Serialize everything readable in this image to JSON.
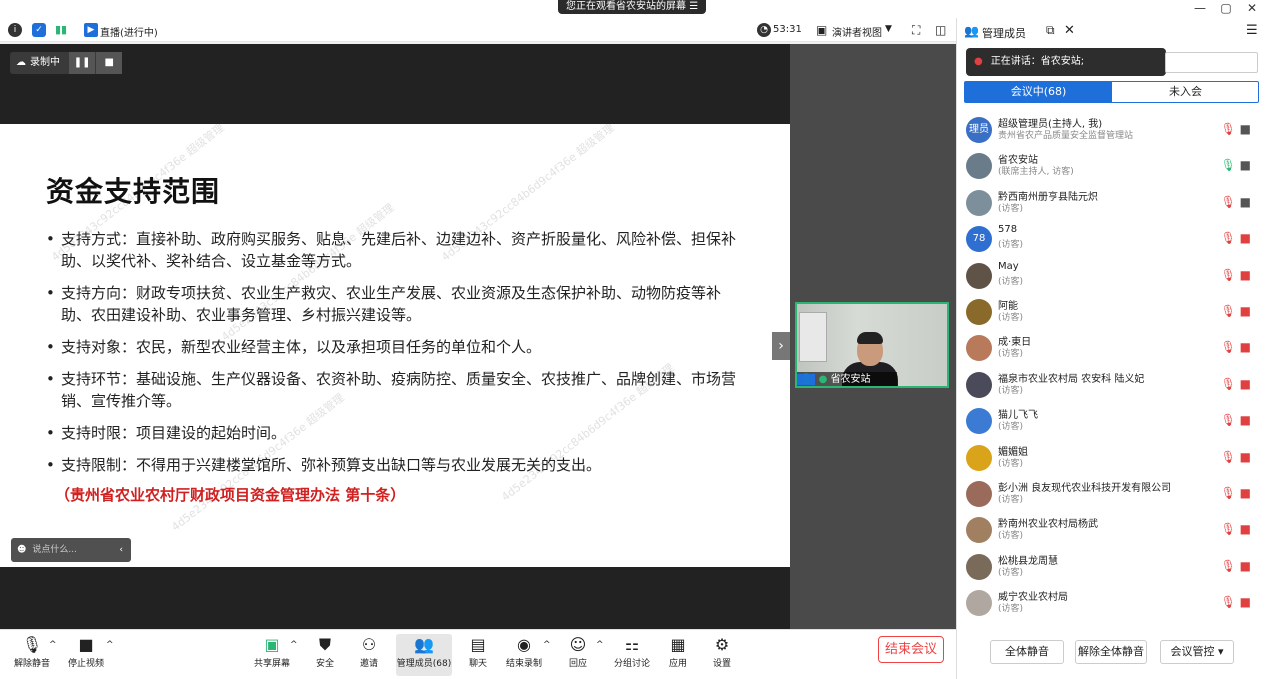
{
  "banner": {
    "text": "您正在观看省农安站的屏幕",
    "icon": "menu-icon"
  },
  "window": {
    "minimize": "—",
    "restore": "▢",
    "close": "✕"
  },
  "meeting_bar": {
    "live_label": "直播(进行中)",
    "timer": "53:31",
    "view_label": "演讲者视图"
  },
  "recording": {
    "label": "录制中"
  },
  "slide": {
    "title": "资金支持范围",
    "bullets": [
      "支持方式：直接补助、政府购买服务、贴息、先建后补、边建边补、资产折股量化、风险补偿、担保补助、以奖代补、奖补结合、设立基金等方式。",
      "支持方向：财政专项扶贫、农业生产救灾、农业生产发展、农业资源及生态保护补助、动物防疫等补助、农田建设补助、农业事务管理、乡村振兴建设等。",
      "支持对象：农民，新型农业经营主体，以及承担项目任务的单位和个人。",
      "支持环节：基础设施、生产仪器设备、农资补助、疫病防控、质量安全、农技推广、品牌创建、市场营销、宣传推介等。",
      "支持时限：项目建设的起始时间。",
      "支持限制：不得用于兴建楼堂馆所、弥补预算支出缺口等与农业发展无关的支出。"
    ],
    "note": "（贵州省农业农村厅财政项目资金管理办法 第十条）"
  },
  "chat": {
    "placeholder": "说点什么..."
  },
  "video": {
    "caption": "省农安站"
  },
  "toolbar": {
    "unmute": "解除静音",
    "stop_video": "停止视频",
    "share": "共享屏幕",
    "security": "安全",
    "invite": "邀请",
    "members": "管理成员(68)",
    "chat": "聊天",
    "end_record": "结束录制",
    "reactions": "回应",
    "breakout": "分组讨论",
    "apps": "应用",
    "settings": "设置",
    "end_meeting": "结束会议"
  },
  "panel": {
    "title": "管理成员",
    "speaking": "正在讲话：省农安站;",
    "tab_in": "会议中(68)",
    "tab_out": "未入会",
    "members": [
      {
        "name": "超级管理员(主持人, 我)",
        "role": "贵州省农产品质量安全监督管理站",
        "avatar": "理员",
        "mic": "off",
        "cam": "on"
      },
      {
        "name": "省农安站",
        "role": "(联席主持人, 访客)",
        "avatar": "",
        "mic": "on",
        "cam": "on"
      },
      {
        "name": "黔西南州册亨县陆元炽",
        "role": "(访客)",
        "avatar": "",
        "mic": "off",
        "cam": "on"
      },
      {
        "name": "578",
        "role": "(访客)",
        "avatar": "78",
        "mic": "off",
        "cam": "off"
      },
      {
        "name": "May",
        "role": "(访客)",
        "avatar": "",
        "mic": "off",
        "cam": "off"
      },
      {
        "name": "阿能",
        "role": "(访客)",
        "avatar": "",
        "mic": "off",
        "cam": "off"
      },
      {
        "name": "成·東日",
        "role": "(访客)",
        "avatar": "",
        "mic": "off",
        "cam": "off"
      },
      {
        "name": "福泉市农业农村局 农安科 陆义妃",
        "role": "(访客)",
        "avatar": "",
        "mic": "off",
        "cam": "off"
      },
      {
        "name": "猫儿飞飞",
        "role": "(访客)",
        "avatar": "",
        "mic": "off",
        "cam": "off"
      },
      {
        "name": "媚媚姐",
        "role": "(访客)",
        "avatar": "",
        "mic": "off",
        "cam": "off"
      },
      {
        "name": "彭小洲 良友现代农业科技开发有限公司",
        "role": "(访客)",
        "avatar": "",
        "mic": "off",
        "cam": "off"
      },
      {
        "name": "黔南州农业农村局杨武",
        "role": "(访客)",
        "avatar": "",
        "mic": "off",
        "cam": "off"
      },
      {
        "name": "松桃县龙周慧",
        "role": "(访客)",
        "avatar": "",
        "mic": "off",
        "cam": "off"
      },
      {
        "name": "威宁农业农村局",
        "role": "(访客)",
        "avatar": "",
        "mic": "off",
        "cam": "off"
      }
    ],
    "mute_all": "全体静音",
    "unmute_all": "解除全体静音",
    "controls": "会议管控"
  },
  "colors": {
    "accent": "#1e6fd9",
    "danger": "#e04040",
    "green": "#2bb673"
  }
}
